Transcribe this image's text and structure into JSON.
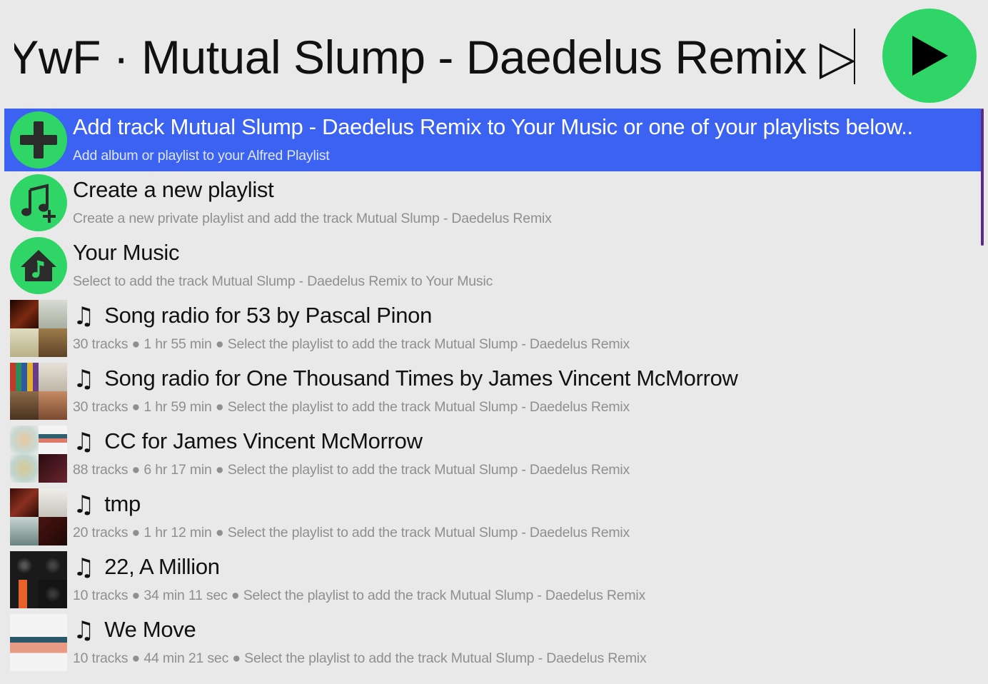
{
  "search": {
    "query": "nkYwF · Mutual Slump - Daedelus Remix ▷"
  },
  "play_button": {
    "icon": "play-icon",
    "color": "#2fd566"
  },
  "accent_colors": {
    "selected_row": "#3b62f1",
    "icon_green": "#2fd566"
  },
  "results": [
    {
      "icon": "plus-icon",
      "title": "Add track Mutual Slump - Daedelus Remix to Your Music or one of your playlists below..",
      "subtitle": "Add album or playlist to your Alfred Playlist",
      "selected": true
    },
    {
      "icon": "music-plus-icon",
      "title": "Create a new playlist",
      "subtitle": "Create a new private playlist and add the track Mutual Slump - Daedelus Remix"
    },
    {
      "icon": "home-music-icon",
      "title": "Your Music",
      "subtitle": "Select to add the track Mutual Slump - Daedelus Remix to Your Music"
    },
    {
      "icon": "playlist-artwork",
      "note": "♫",
      "title": "Song radio for 53 by Pascal Pinon",
      "subtitle": "30 tracks ● 1 hr 55 min ● Select the playlist to add the track Mutual Slump - Daedelus Remix",
      "art_colors": [
        "#3a0d08",
        "#c9cfc4",
        "#c8c2a0",
        "#8a6a40"
      ]
    },
    {
      "icon": "playlist-artwork",
      "note": "♫",
      "title": "Song radio for One Thousand Times by James Vincent McMorrow",
      "subtitle": "30 tracks ● 1 hr 59 min ● Select the playlist to add the track Mutual Slump - Daedelus Remix",
      "art_colors": [
        "#3a7d3a",
        "#d9d4cc",
        "#6b4a2e",
        "#a87a56"
      ]
    },
    {
      "icon": "playlist-artwork",
      "note": "♫",
      "title": "CC for James Vincent McMorrow",
      "subtitle": "88 tracks ● 6 hr 17 min ● Select the playlist to add the track Mutual Slump - Daedelus Remix",
      "art_colors": [
        "#d9d2b8",
        "#8fc7c4",
        "#cfc8ad",
        "#4a1e22"
      ]
    },
    {
      "icon": "playlist-artwork",
      "note": "♫",
      "title": "tmp",
      "subtitle": "20 tracks ● 1 hr 12 min ● Select the playlist to add the track Mutual Slump - Daedelus Remix",
      "art_colors": [
        "#5a1a14",
        "#e6e3df",
        "#a9b9b8",
        "#3b1712"
      ]
    },
    {
      "icon": "playlist-artwork",
      "note": "♫",
      "title": "22, A Million",
      "subtitle": "10 tracks ● 34 min 11 sec ● Select the playlist to add the track Mutual Slump - Daedelus Remix",
      "art_colors": [
        "#1a1a1a",
        "#2a2a2a",
        "#222222",
        "#111111"
      ]
    },
    {
      "icon": "playlist-artwork",
      "note": "♫",
      "title": "We Move",
      "subtitle": "10 tracks ● 44 min 21 sec ● Select the playlist to add the track Mutual Slump - Daedelus Remix",
      "art_colors": [
        "#f2f2f2",
        "#f2f2f2",
        "#e8a892",
        "#f2f2f2"
      ]
    }
  ]
}
